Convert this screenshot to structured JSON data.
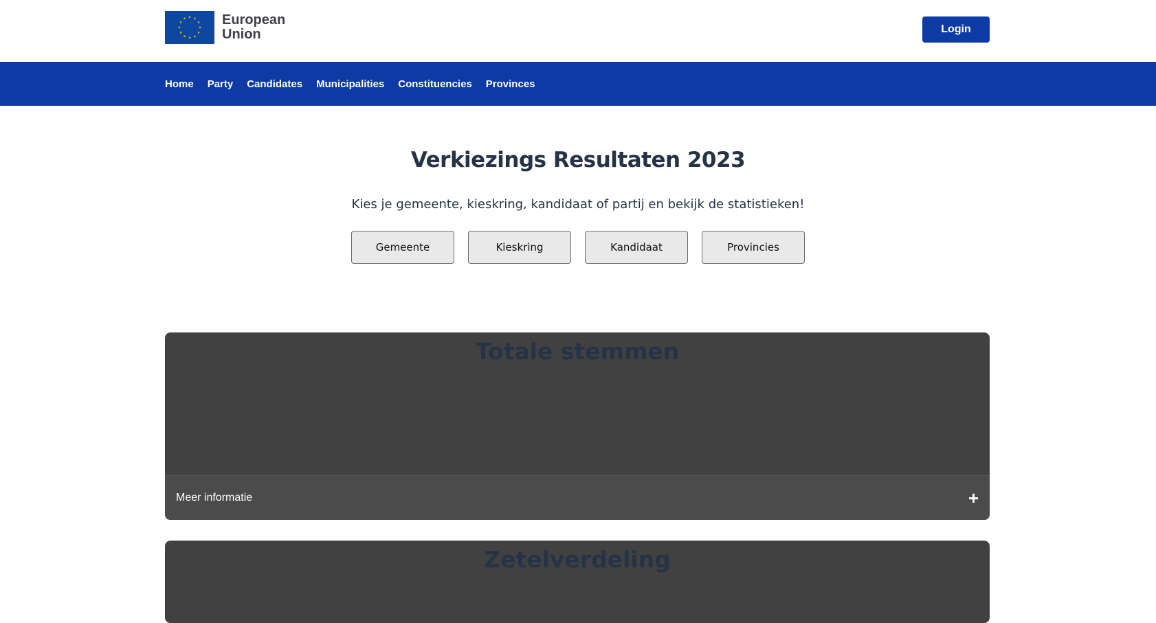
{
  "header": {
    "brand_line1": "European",
    "brand_line2": "Union",
    "login_label": "Login",
    "flag_color": "#0e47a1",
    "star_color": "#f6c900"
  },
  "nav": {
    "items": [
      {
        "label": "Home"
      },
      {
        "label": "Party"
      },
      {
        "label": "Candidates"
      },
      {
        "label": "Municipalities"
      },
      {
        "label": "Constituencies"
      },
      {
        "label": "Provinces"
      }
    ],
    "background": "#0e3aa5"
  },
  "hero": {
    "title": "Verkiezings Resultaten 2023",
    "subtitle": "Kies je gemeente, kieskring, kandidaat of partij en bekijk de statistieken!",
    "buttons": [
      {
        "label": "Gemeente"
      },
      {
        "label": "Kieskring"
      },
      {
        "label": "Kandidaat"
      },
      {
        "label": "Provincies"
      }
    ]
  },
  "panels": {
    "votes": {
      "title": "Totale stemmen",
      "footer_label": "Meer informatie",
      "toggle_icon": "plus-icon"
    },
    "seats": {
      "title": "Zetelverdeling"
    }
  }
}
